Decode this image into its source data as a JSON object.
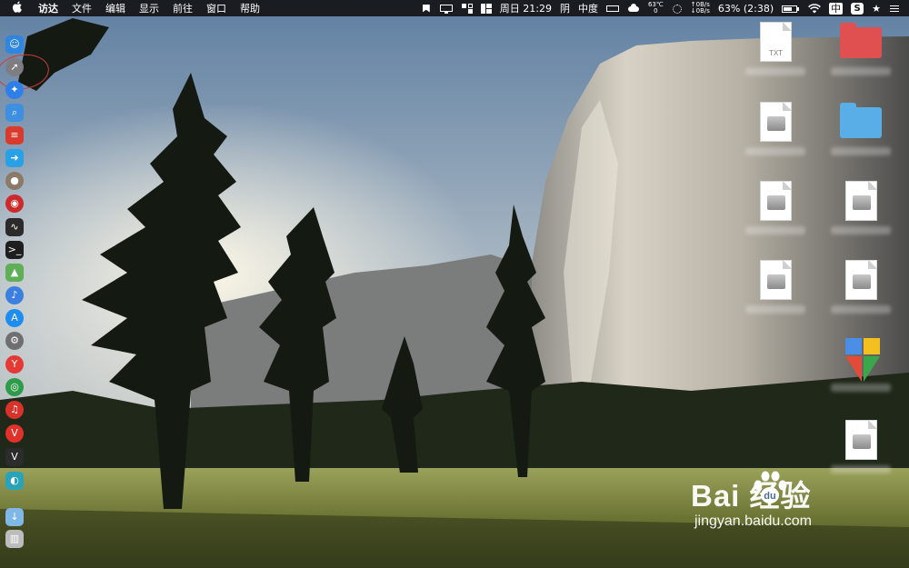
{
  "menubar": {
    "apple_symbol": "",
    "items": [
      "访达",
      "文件",
      "编辑",
      "显示",
      "前往",
      "窗口",
      "帮助"
    ],
    "status": {
      "datetime": "周日 21:29",
      "weather": "阴",
      "air": "中度",
      "cpu_temp": "63℃",
      "cpu_temp_sub": "0",
      "net_up": "↑0B/s",
      "net_down": "↓0B/s",
      "battery": "63% (2:38)",
      "input_method": "中",
      "s_badge": "S",
      "star": "★"
    }
  },
  "dock": {
    "items": [
      {
        "name": "finder",
        "glyph": "☺",
        "color": "#2f86e0"
      },
      {
        "name": "launchpad",
        "glyph": "➚",
        "color": "#7d7d82"
      },
      {
        "name": "safari",
        "glyph": "✦",
        "color": "#2f7fe8"
      },
      {
        "name": "preview-search",
        "glyph": "⌕",
        "color": "#3f8fe0"
      },
      {
        "name": "app-red",
        "glyph": "≡",
        "color": "#d93a2b"
      },
      {
        "name": "migration",
        "glyph": "➜",
        "color": "#2aa0e6"
      },
      {
        "name": "app-stone",
        "glyph": "●",
        "color": "#8b7a66"
      },
      {
        "name": "app-red-round",
        "glyph": "◉",
        "color": "#cc2a2a"
      },
      {
        "name": "activity-monitor",
        "glyph": "∿",
        "color": "#2b2b2b"
      },
      {
        "name": "terminal",
        "glyph": ">_",
        "color": "#1e1e1e"
      },
      {
        "name": "maps",
        "glyph": "▲",
        "color": "#5fae58"
      },
      {
        "name": "siri",
        "glyph": "♪",
        "color": "#3b7fe0"
      },
      {
        "name": "app-store",
        "glyph": "A",
        "color": "#1e8cf0"
      },
      {
        "name": "system-preferences",
        "glyph": "⚙",
        "color": "#6f6f72"
      },
      {
        "name": "yandex",
        "glyph": "Y",
        "color": "#e53935"
      },
      {
        "name": "chrome",
        "glyph": "◎",
        "color": "#2e9b4a"
      },
      {
        "name": "netease-music",
        "glyph": "♫",
        "color": "#d8332b"
      },
      {
        "name": "vivaldi",
        "glyph": "V",
        "color": "#e0322b"
      },
      {
        "name": "vim",
        "glyph": "V",
        "color": "#2c2c2c"
      },
      {
        "name": "app-teal",
        "glyph": "◐",
        "color": "#2aa3b8"
      },
      {
        "name": "downloads-folder",
        "glyph": "↓",
        "color": "#7fb8e6"
      },
      {
        "name": "trash",
        "glyph": "▥",
        "color": "#bcbcbc"
      }
    ]
  },
  "desktop": {
    "icons": [
      {
        "name": "txt-file",
        "kind": "txt",
        "ext": "TXT"
      },
      {
        "name": "red-folder",
        "kind": "folder",
        "color": "#e05050"
      },
      {
        "name": "disk-image-1",
        "kind": "dmg"
      },
      {
        "name": "blue-folder",
        "kind": "folder",
        "color": "#5aaee8"
      },
      {
        "name": "disk-image-2",
        "kind": "dmg"
      },
      {
        "name": "disk-image-3",
        "kind": "dmg"
      },
      {
        "name": "disk-image-4",
        "kind": "dmg"
      },
      {
        "name": "disk-image-5",
        "kind": "dmg"
      },
      {
        "name": "office-app",
        "kind": "app"
      },
      {
        "name": "disk-image-6",
        "kind": "dmg"
      }
    ]
  },
  "watermark": {
    "brand": "Bai  经验",
    "url": "jingyan.baidu.com"
  },
  "colors": {
    "menubar": "#141416",
    "launch_circle": "#d23a3a"
  }
}
